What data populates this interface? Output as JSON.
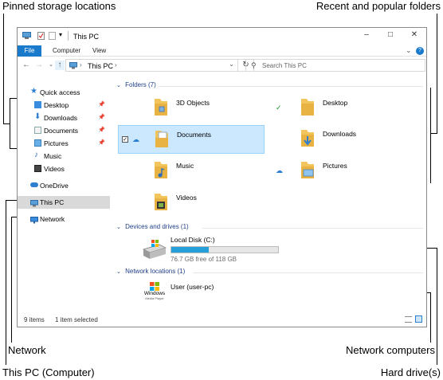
{
  "callouts": {
    "pinned": "Pinned storage locations",
    "recent": "Recent and popular folders",
    "network": "Network",
    "network_computers": "Network computers",
    "this_pc": "This PC (Computer)",
    "hard_drives": "Hard drive(s)"
  },
  "window": {
    "title": "This PC",
    "ribbon_tabs": [
      "File",
      "Computer",
      "View"
    ],
    "breadcrumb": "This PC",
    "search_placeholder": "Search This PC"
  },
  "nav": {
    "quick_access": "Quick access",
    "pinned": [
      {
        "label": "Desktop",
        "icon": "desktop-icon"
      },
      {
        "label": "Downloads",
        "icon": "downloads-icon"
      },
      {
        "label": "Documents",
        "icon": "documents-icon"
      },
      {
        "label": "Pictures",
        "icon": "pictures-icon"
      }
    ],
    "other": [
      {
        "label": "Music",
        "icon": "music-icon"
      },
      {
        "label": "Videos",
        "icon": "videos-icon"
      }
    ],
    "onedrive": "OneDrive",
    "this_pc": "This PC",
    "network": "Network"
  },
  "content": {
    "folders_header": "Folders (7)",
    "folders": [
      {
        "label": "3D Objects"
      },
      {
        "label": "Desktop"
      },
      {
        "label": "Documents"
      },
      {
        "label": "Downloads"
      },
      {
        "label": "Music"
      },
      {
        "label": "Pictures"
      },
      {
        "label": "Videos"
      }
    ],
    "devices_header": "Devices and drives (1)",
    "drive": {
      "name": "Local Disk (C:)",
      "free": "76.7 GB free of 118 GB",
      "used_fraction": 0.35
    },
    "network_header": "Network locations (1)",
    "network_item": {
      "name": "User (user-pc)",
      "logo_text": "Windows",
      "logo_sub": "Media Player"
    }
  },
  "statusbar": {
    "items": "9 items",
    "selected": "1 item selected"
  },
  "colors": {
    "accent": "#1979ca",
    "group_header": "#1e3f8a",
    "selection": "#cce8ff",
    "folder": "#f2c55c"
  }
}
